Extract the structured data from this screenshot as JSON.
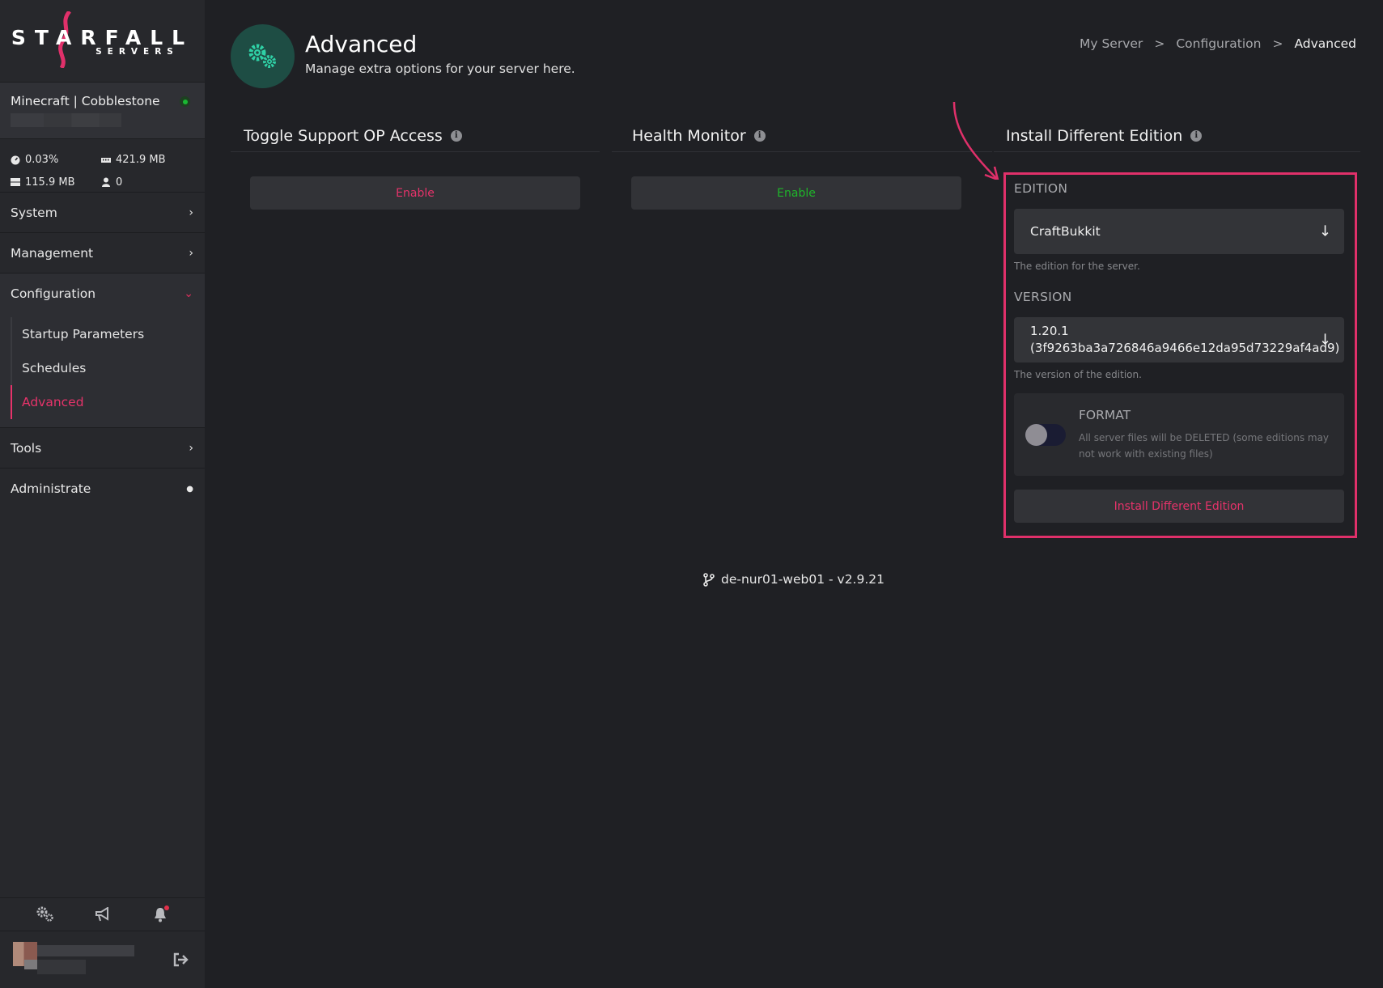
{
  "brand": {
    "name": "STARFALL",
    "sub": "SERVERS",
    "accent": "#e0306a"
  },
  "server": {
    "name": "Minecraft | Cobblestone",
    "status_color": "#1ab833"
  },
  "stats": {
    "cpu": "0.03%",
    "memory": "421.9 MB",
    "disk": "115.9 MB",
    "players": "0"
  },
  "nav": {
    "system": "System",
    "management": "Management",
    "configuration": "Configuration",
    "config_items": [
      "Startup Parameters",
      "Schedules",
      "Advanced"
    ],
    "tools": "Tools",
    "administrate": "Administrate"
  },
  "header": {
    "title": "Advanced",
    "subtitle": "Manage extra options for your server here.",
    "breadcrumb": [
      "My Server",
      "Configuration",
      "Advanced"
    ],
    "breadcrumb_sep": ">"
  },
  "cards": {
    "support_op": {
      "title": "Toggle Support OP Access",
      "button": "Enable",
      "button_color": "#e6336a"
    },
    "health": {
      "title": "Health Monitor",
      "button": "Enable",
      "button_color": "#1fb52a"
    },
    "install": {
      "title": "Install Different Edition",
      "edition_label": "EDITION",
      "edition_value": "CraftBukkit",
      "edition_help": "The edition for the server.",
      "version_label": "VERSION",
      "version_line1": "1.20.1",
      "version_line2": "(3f9263ba3a726846a9466e12da95d73229af4ad9)",
      "version_help": "The version of the edition.",
      "format_title": "FORMAT",
      "format_desc": "All server files will be DELETED (some editions may not work with existing files)",
      "format_enabled": false,
      "button": "Install Different Edition"
    }
  },
  "footer": {
    "text": "de-nur01-web01 - v2.9.21"
  },
  "icons": [
    "settings-icon",
    "megaphone-icon",
    "bell-icon",
    "logout-icon",
    "info-icon",
    "git-branch-icon",
    "gears-icon"
  ]
}
